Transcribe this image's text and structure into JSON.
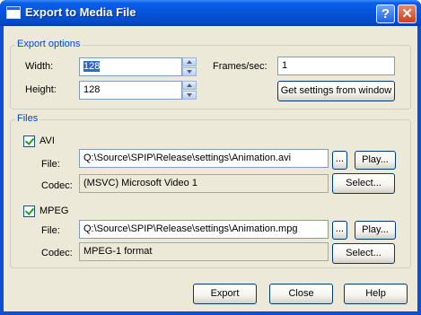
{
  "window": {
    "title": "Export to Media File",
    "help_label": "?",
    "close_label": "✕",
    "icon": "app-window-icon"
  },
  "export_options": {
    "group_title": "Export options",
    "width_label": "Width:",
    "width_value": "128",
    "height_label": "Height:",
    "height_value": "128",
    "fps_label": "Frames/sec:",
    "fps_value": "1",
    "get_settings_label": "Get settings from window"
  },
  "files": {
    "group_title": "Files",
    "avi": {
      "checkbox_label": "AVI",
      "checked": true,
      "file_label": "File:",
      "file_value": "Q:\\Source\\SPIP\\Release\\settings\\Animation.avi",
      "browse_label": "...",
      "play_label": "Play...",
      "codec_label": "Codec:",
      "codec_value": "(MSVC) Microsoft Video 1",
      "select_label": "Select..."
    },
    "mpeg": {
      "checkbox_label": "MPEG",
      "checked": true,
      "file_label": "File:",
      "file_value": "Q:\\Source\\SPIP\\Release\\settings\\Animation.mpg",
      "browse_label": "...",
      "play_label": "Play...",
      "codec_label": "Codec:",
      "codec_value": "MPEG-1 format",
      "select_label": "Select..."
    }
  },
  "footer": {
    "export_label": "Export",
    "close_label": "Close",
    "help_label": "Help"
  }
}
